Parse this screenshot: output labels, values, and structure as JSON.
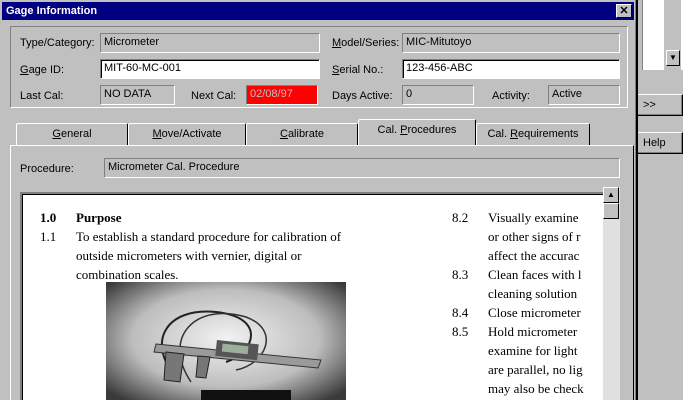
{
  "window": {
    "title": "Gage Information",
    "close_glyph": "✕"
  },
  "fields": {
    "type_category": {
      "label": "Type/Category:",
      "value": "Micrometer"
    },
    "model_series": {
      "label_u": "M",
      "label_rest": "odel/Series:",
      "value": "MIC-Mitutoyo"
    },
    "gage_id": {
      "label_u": "G",
      "label_rest": "age ID:",
      "value": "MIT-60-MC-001"
    },
    "serial_no": {
      "label_u": "S",
      "label_rest": "erial No.:",
      "value": "123-456-ABC"
    },
    "last_cal": {
      "label": "Last Cal:",
      "value": "NO DATA"
    },
    "next_cal": {
      "label": "Next Cal:",
      "value": "02/08/97"
    },
    "days_active": {
      "label": "Days Active:",
      "value": "0"
    },
    "activity": {
      "label": "Activity:",
      "value": "Active"
    }
  },
  "tabs": [
    {
      "u": "G",
      "rest": "eneral"
    },
    {
      "u": "M",
      "rest": "ove/Activate"
    },
    {
      "u": "C",
      "rest": "alibrate"
    },
    {
      "pre": "Cal. ",
      "u": "P",
      "rest": "rocedures"
    },
    {
      "pre": "Cal. ",
      "u": "R",
      "rest": "equirements"
    }
  ],
  "active_tab": "Cal. Procedures",
  "procedure": {
    "label": "Procedure:",
    "value": "Micrometer Cal. Procedure"
  },
  "document": {
    "left": {
      "heading_num": "1.0",
      "heading_text": "Purpose",
      "item_num": "1.1",
      "item_lines": [
        "To establish a standard procedure for calibration of",
        "outside micrometers with vernier, digital or",
        "combination scales."
      ]
    },
    "right": [
      {
        "num": "8.2",
        "lines": [
          "Visually examine",
          "or other signs of r",
          "affect the accurac"
        ]
      },
      {
        "num": "8.3",
        "lines": [
          "Clean faces with l",
          "cleaning solution"
        ]
      },
      {
        "num": "8.4",
        "lines": [
          "Close micrometer"
        ]
      },
      {
        "num": "8.5",
        "lines": [
          "Hold micrometer",
          "examine for light",
          "are parallel, no lig",
          "may also be check"
        ]
      }
    ]
  },
  "background": {
    "button_1": ">>",
    "button_2": "Help"
  },
  "colors": {
    "title_bar": "#000080",
    "next_cal_bg": "#ff0000",
    "face": "#c0c0c0"
  }
}
